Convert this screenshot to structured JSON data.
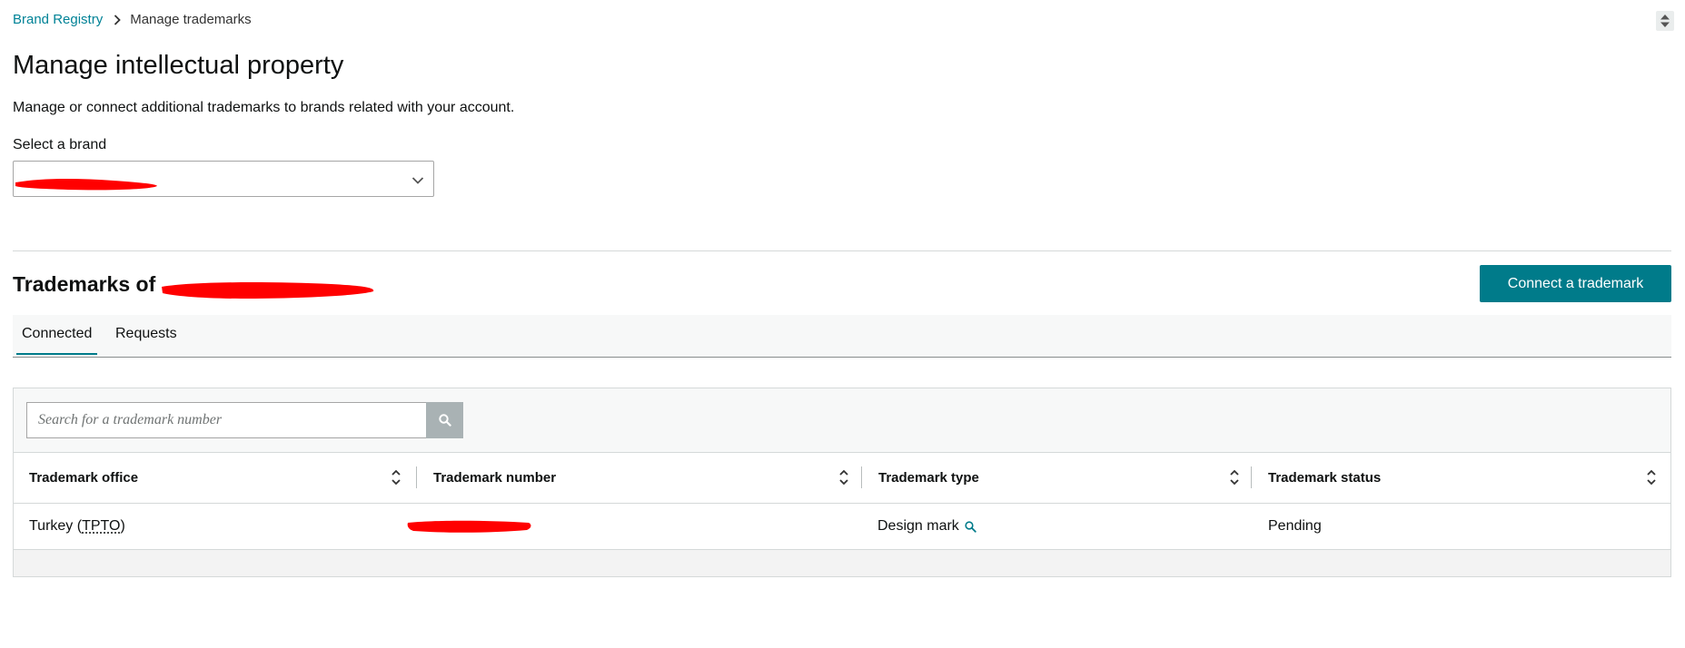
{
  "breadcrumb": {
    "root": "Brand Registry",
    "current": "Manage trademarks"
  },
  "page": {
    "title": "Manage intellectual property",
    "subtitle": "Manage or connect additional trademarks to brands related with your account."
  },
  "brand_select": {
    "label": "Select a brand",
    "value": "",
    "redacted": true
  },
  "trademarks": {
    "title_prefix": "Trademarks of",
    "connect_button": "Connect a trademark"
  },
  "tabs": [
    {
      "label": "Connected",
      "active": true
    },
    {
      "label": "Requests",
      "active": false
    }
  ],
  "search": {
    "placeholder": "Search for a trademark number"
  },
  "table": {
    "columns": [
      "Trademark office",
      "Trademark number",
      "Trademark type",
      "Trademark status"
    ],
    "rows": [
      {
        "office_country": "Turkey",
        "office_code": "TPTO",
        "number": "",
        "number_redacted": true,
        "type": "Design mark",
        "status": "Pending"
      }
    ]
  },
  "colors": {
    "accent": "#007b8a",
    "link": "#008296",
    "redaction": "#ff0000"
  },
  "icons": [
    "chevron-right-icon",
    "chevron-down-icon",
    "sort-icon",
    "search-icon",
    "magnifier-icon"
  ]
}
